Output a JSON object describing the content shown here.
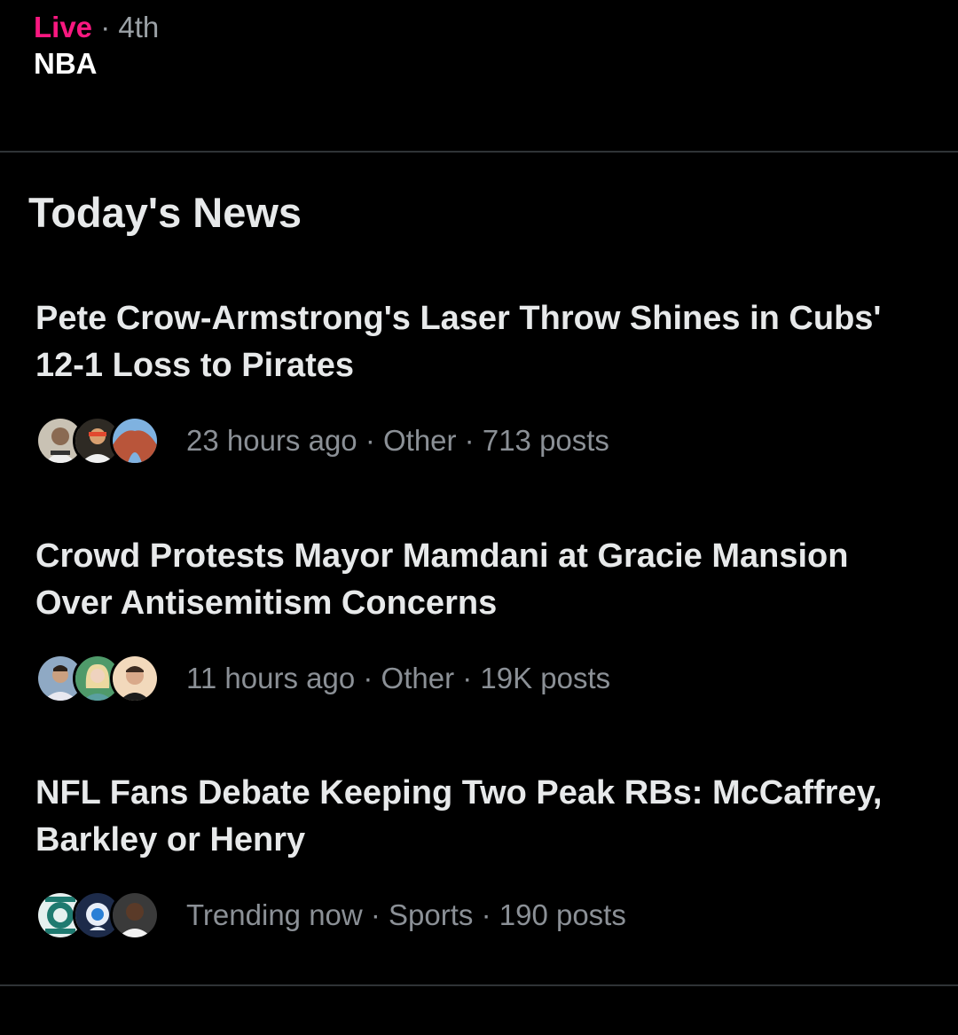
{
  "live": {
    "label": "Live",
    "separator": "·",
    "period": "4th",
    "league": "NBA",
    "accent_color": "#f91880"
  },
  "todays_news": {
    "title": "Today's News",
    "items": [
      {
        "headline_line1": "Pete Crow-Armstrong's Laser Throw Shines in Cubs'",
        "headline_line2": "12-1 Loss to Pirates",
        "meta": "23 hours ago · Other · 713 posts",
        "avatars": [
          "baseball-player-avatar",
          "pirates-fan-avatar",
          "red-rock-arch-avatar"
        ]
      },
      {
        "headline_line1": "Crowd Protests Mayor Mamdani at Gracie Mansion",
        "headline_line2": "Over Antisemitism Concerns",
        "meta": "11 hours ago · Other · 19K posts",
        "avatars": [
          "man-outdoors-avatar",
          "blonde-woman-avatar",
          "man-portrait-avatar"
        ]
      },
      {
        "headline_line1": "NFL Fans Debate Keeping Two Peak RBs: McCaffrey,",
        "headline_line2": "Barkley or Henry",
        "meta": "Trending now · Sports · 190 posts",
        "avatars": [
          "sleeper-eagles-logo-avatar",
          "sleeper-logo-avatar",
          "football-player-avatar"
        ]
      }
    ]
  },
  "colors": {
    "background": "#000000",
    "text_primary": "#e7e9ea",
    "text_secondary": "#8b9096",
    "divider": "#2f3336"
  }
}
